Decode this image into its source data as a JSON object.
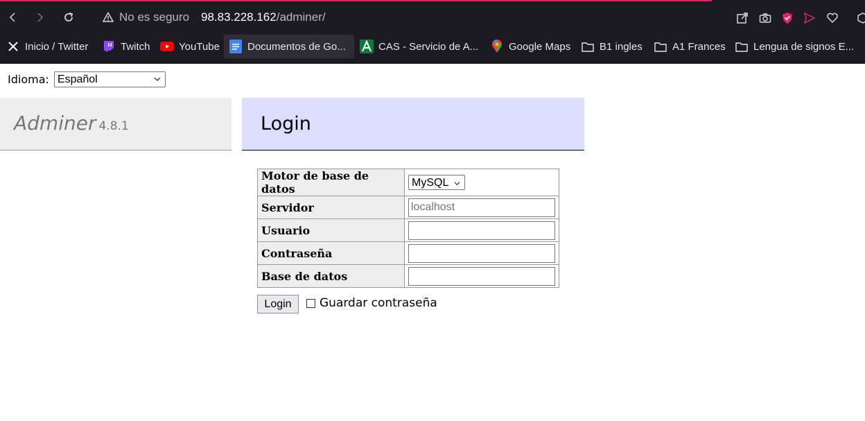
{
  "browser": {
    "security_label": "No es seguro",
    "url_host": "98.83.228.162",
    "url_path": "/adminer/",
    "accent_color": "#e0245e"
  },
  "bookmarks": [
    {
      "label": "Inicio / Twitter",
      "icon": "x-logo-icon"
    },
    {
      "label": "Twitch",
      "icon": "twitch-icon"
    },
    {
      "label": "YouTube",
      "icon": "youtube-icon"
    },
    {
      "label": "Documentos de Go...",
      "icon": "google-docs-icon"
    },
    {
      "label": "CAS - Servicio de A...",
      "icon": "cas-icon"
    },
    {
      "label": "Google Maps",
      "icon": "map-pin-icon"
    },
    {
      "label": "B1 ingles",
      "icon": "folder-icon"
    },
    {
      "label": "A1 Frances",
      "icon": "folder-icon"
    },
    {
      "label": "Lengua de signos E...",
      "icon": "folder-icon"
    }
  ],
  "language": {
    "label": "Idioma:",
    "selected": "Español"
  },
  "sidebar": {
    "app_name": "Adminer",
    "version": "4.8.1"
  },
  "main": {
    "heading": "Login",
    "fields": {
      "engine_label": "Motor de base de datos",
      "engine_value": "MySQL",
      "server_label": "Servidor",
      "server_placeholder": "localhost",
      "user_label": "Usuario",
      "password_label": "Contraseña",
      "database_label": "Base de datos"
    },
    "login_button": "Login",
    "remember_label": "Guardar contraseña"
  }
}
